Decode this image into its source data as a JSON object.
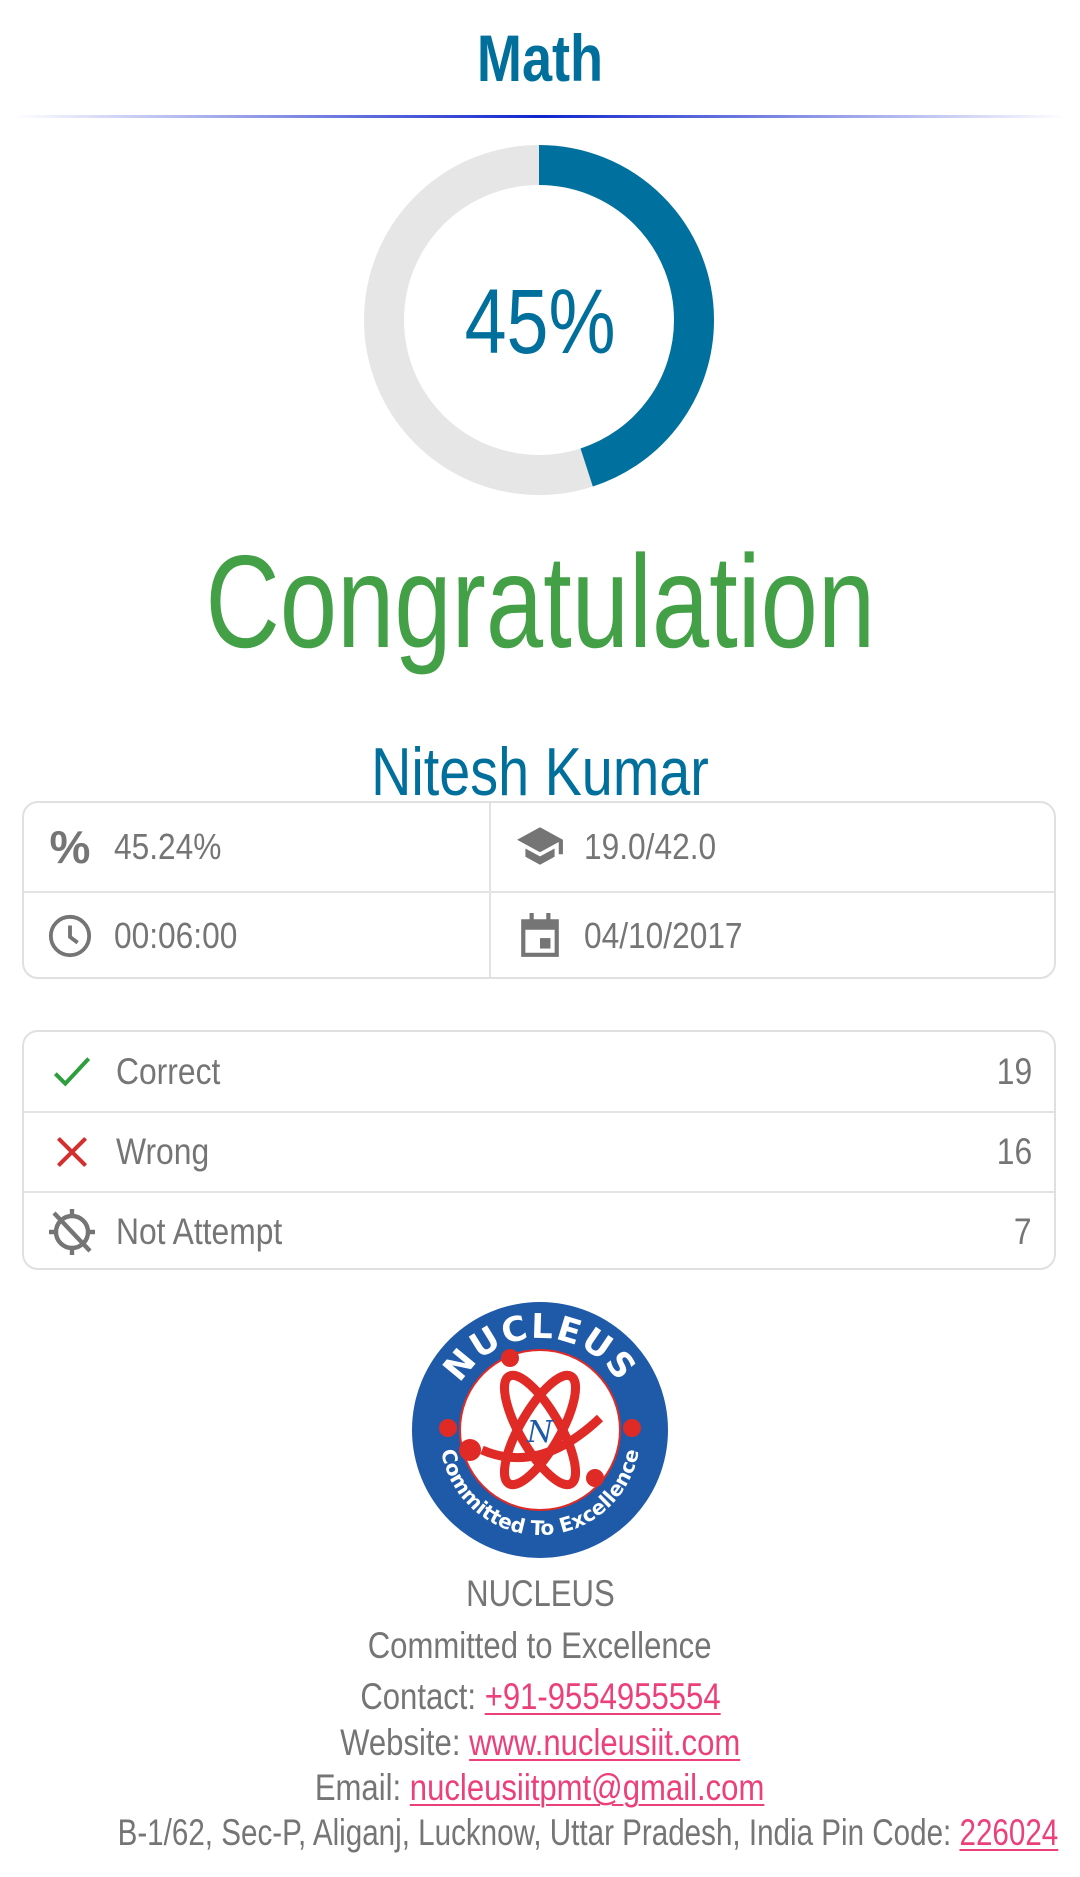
{
  "header": {
    "title": "Math"
  },
  "score_ring": {
    "percent": 45,
    "label": "45%",
    "colors": {
      "fill": "#00709e",
      "track": "#e6e6e6"
    }
  },
  "result": {
    "message": "Congratulation",
    "student_name": "Nitesh Kumar",
    "message_color": "#43a047"
  },
  "summary": {
    "percentage": {
      "icon": "percent-icon",
      "value": "45.24%"
    },
    "marks": {
      "icon": "graduation-cap-icon",
      "value": "19.0/42.0"
    },
    "time_taken": {
      "icon": "clock-icon",
      "value": "00:06:00"
    },
    "date": {
      "icon": "calendar-icon",
      "value": "04/10/2017"
    }
  },
  "stats": [
    {
      "icon": "check-icon",
      "label": "Correct",
      "count": "19",
      "icon_color": "#2e9e3e"
    },
    {
      "icon": "close-icon",
      "label": "Wrong",
      "count": "16",
      "icon_color": "#d32f2f"
    },
    {
      "icon": "not-attempted-icon",
      "label": "Not Attempt",
      "count": "7",
      "icon_color": "#757575"
    }
  ],
  "footer": {
    "logo": {
      "top_text": "NUCLEUS",
      "bottom_text": "Committed To Excellence",
      "monogram": "N",
      "colors": {
        "ring": "#1f5aa8",
        "atom": "#e02a26"
      }
    },
    "brand": "NUCLEUS",
    "tagline": "Committed to Excellence",
    "contact_label": "Contact: ",
    "contact_value": "+91-9554955554",
    "website_label": "Website: ",
    "website_value": "www.nucleusiit.com",
    "email_label": "Email: ",
    "email_value": "nucleusiitpmt@gmail.com",
    "address_label": "B-1/62, Sec-P, Aliganj, Lucknow, Uttar Pradesh, India Pin Code: ",
    "pin_code": "226024",
    "link_color": "#ec407a"
  }
}
